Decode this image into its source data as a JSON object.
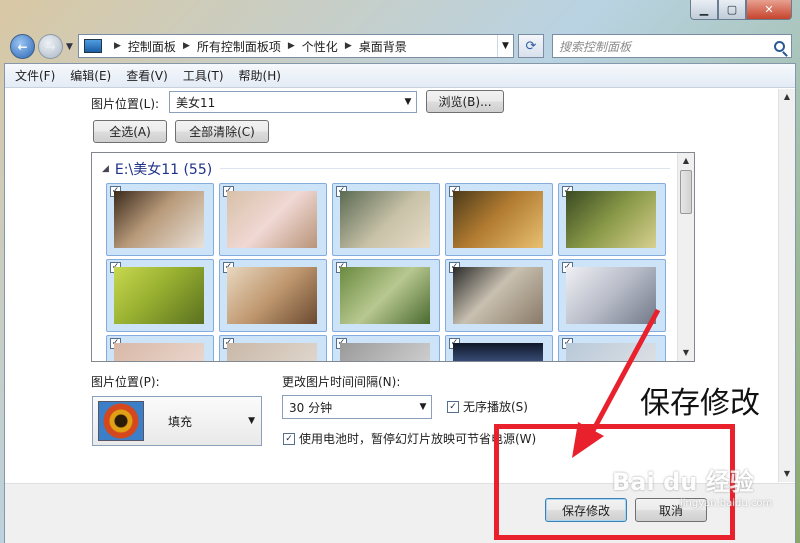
{
  "address": {
    "crumbs": [
      "控制面板",
      "所有控制面板项",
      "个性化",
      "桌面背景"
    ]
  },
  "search": {
    "placeholder": "搜索控制面板"
  },
  "menu": [
    "文件(F)",
    "编辑(E)",
    "查看(V)",
    "工具(T)",
    "帮助(H)"
  ],
  "picture_location": {
    "label": "图片位置(L):",
    "value": "美女11",
    "browse": "浏览(B)..."
  },
  "select_all": "全选(A)",
  "clear_all": "全部清除(C)",
  "gallery": {
    "header": "E:\\美女11 (55)",
    "check_mark": "✓"
  },
  "position": {
    "label": "图片位置(P):",
    "value": "填充"
  },
  "interval": {
    "label": "更改图片时间间隔(N):",
    "value": "30 分钟"
  },
  "shuffle": {
    "label": "无序播放(S)",
    "checked": true
  },
  "battery": {
    "label": "使用电池时，暂停幻灯片放映可节省电源(W)",
    "checked": true
  },
  "buttons": {
    "save": "保存修改",
    "cancel": "取消"
  },
  "annotation": "保存修改",
  "watermark": {
    "logo": "Bai du 经验",
    "url": "jingyan.baidu.com"
  },
  "colors": {
    "accent": "#e8212c",
    "selection": "#cde3f7"
  }
}
